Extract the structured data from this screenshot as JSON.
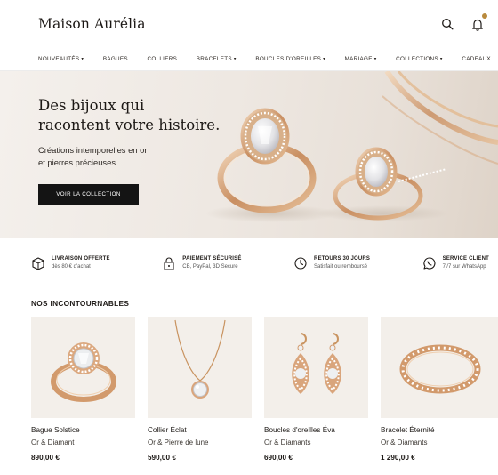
{
  "brand": {
    "name": "Maison Aurélia"
  },
  "header": {
    "icons": [
      "search-icon",
      "bell-icon"
    ],
    "accent": "#b98a3d"
  },
  "nav": {
    "items": [
      {
        "label": "Nouveautés",
        "dropdown": true
      },
      {
        "label": "Bagues",
        "dropdown": false
      },
      {
        "label": "Colliers",
        "dropdown": false
      },
      {
        "label": "Bracelets",
        "dropdown": true
      },
      {
        "label": "Boucles d'oreilles",
        "dropdown": true
      },
      {
        "label": "Mariage",
        "dropdown": true
      },
      {
        "label": "Collections",
        "dropdown": true
      },
      {
        "label": "Cadeaux",
        "dropdown": false
      }
    ]
  },
  "hero": {
    "title_line1": "Des bijoux qui",
    "title_line2": "racontent votre histoire.",
    "subtitle_line1": "Créations intemporelles en or",
    "subtitle_line2": "et pierres précieuses.",
    "cta": "VOIR LA COLLECTION"
  },
  "features": [
    {
      "icon": "delivery-box-icon",
      "title": "Livraison offerte",
      "subtitle": "dès 80 € d'achat"
    },
    {
      "icon": "lock-icon",
      "title": "Paiement sécurisé",
      "subtitle": "CB, PayPal, 3D Secure"
    },
    {
      "icon": "clock-return-icon",
      "title": "Retours 30 jours",
      "subtitle": "Satisfait ou remboursé"
    },
    {
      "icon": "whatsapp-icon",
      "title": "Service client",
      "subtitle": "7j/7 sur WhatsApp"
    }
  ],
  "section": {
    "title": "NOS INCONTOURNABLES"
  },
  "products": [
    {
      "name": "Bague Solstice",
      "material": "Or & Diamant",
      "price": "890,00 €",
      "image": "ring"
    },
    {
      "name": "Collier Éclat",
      "material": "Or & Pierre de lune",
      "price": "590,00 €",
      "image": "necklace"
    },
    {
      "name": "Boucles d'oreilles Éva",
      "material": "Or & Diamants",
      "price": "690,00 €",
      "image": "earrings"
    },
    {
      "name": "Bracelet Éternité",
      "material": "Or & Diamants",
      "price": "1 290,00 €",
      "image": "bracelet"
    }
  ]
}
